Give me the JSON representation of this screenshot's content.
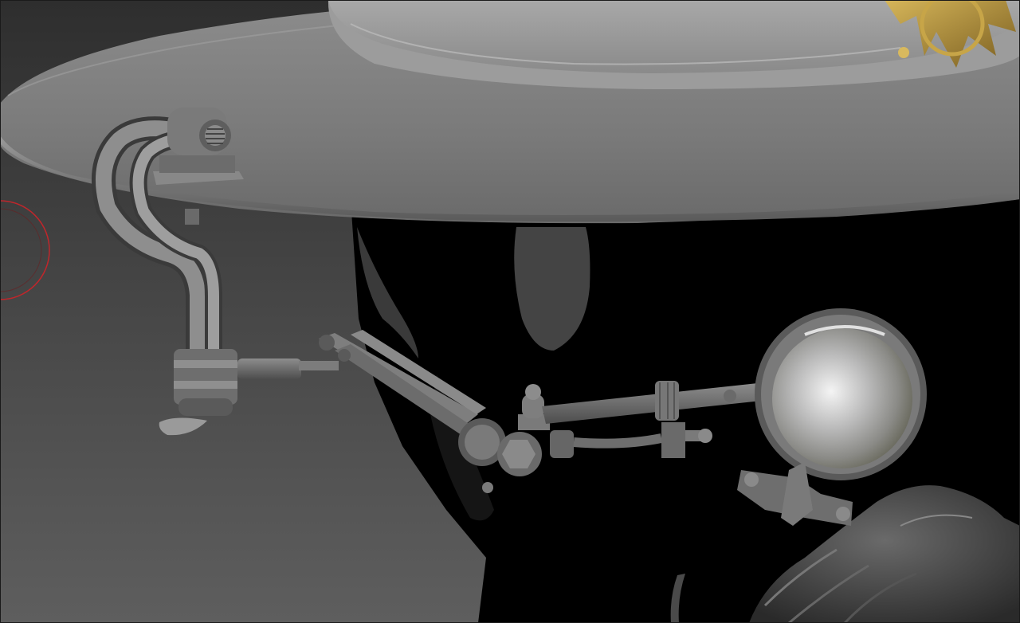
{
  "viewport": {
    "background_top": "#3a3a3a",
    "background_bottom": "#5c5c5c",
    "shadow_color": "#000000",
    "clay_light": "#b5b5b5",
    "clay_mid": "#8a8a8a",
    "clay_dark": "#4a4a4a",
    "gold": "#b8963e",
    "brush_ring_color": "#c0262b",
    "lens_highlight": "#f2f2f2"
  },
  "icons": {
    "brush_cursor": "brush-circle-icon"
  }
}
